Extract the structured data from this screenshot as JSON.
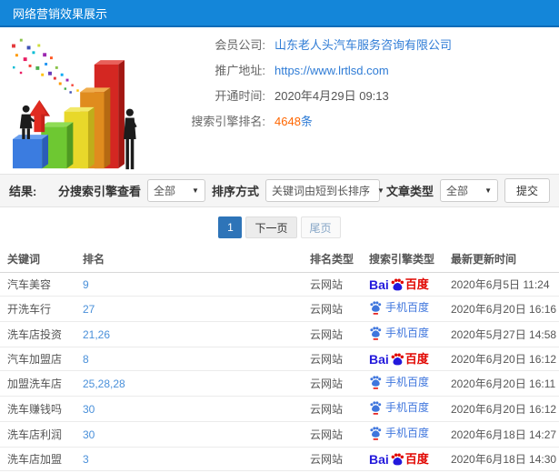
{
  "header": {
    "title": "网络营销效果展示"
  },
  "info": {
    "company_label": "会员公司:",
    "company_value": "山东老人头汽车服务咨询有限公司",
    "url_label": "推广地址:",
    "url_value": "https://www.lrtlsd.com",
    "opened_label": "开通时间:",
    "opened_value": "2020年4月29日 09:13",
    "rank_label": "搜索引擎排名:",
    "rank_count": "4648",
    "rank_unit": "条"
  },
  "filters": {
    "result_label": "结果:",
    "engine_label": "分搜索引擎查看",
    "engine_value": "全部",
    "sort_label": "排序方式",
    "sort_value": "关键词由短到长排序",
    "type_label": "文章类型",
    "type_value": "全部",
    "submit_label": "提交"
  },
  "pagination": {
    "current": "1",
    "next": "下一页",
    "last": "尾页"
  },
  "table": {
    "headers": [
      "关键词",
      "排名",
      "排名类型",
      "搜索引擎类型",
      "最新更新时间"
    ],
    "engine_labels": {
      "baidu": {
        "bai": "Bai",
        "du": "百度"
      },
      "shouji_baidu": {
        "text": "手机百度"
      }
    },
    "rows": [
      {
        "keyword": "汽车美容",
        "rank": "9",
        "rank_type": "云网站",
        "engine": "baidu",
        "time": "2020年6月5日 11:24"
      },
      {
        "keyword": "开洗车行",
        "rank": "27",
        "rank_type": "云网站",
        "engine": "shouji_baidu",
        "time": "2020年6月20日 16:16"
      },
      {
        "keyword": "洗车店投资",
        "rank": "21,26",
        "rank_type": "云网站",
        "engine": "shouji_baidu",
        "time": "2020年5月27日 14:58"
      },
      {
        "keyword": "汽车加盟店",
        "rank": "8",
        "rank_type": "云网站",
        "engine": "baidu",
        "time": "2020年6月20日 16:12"
      },
      {
        "keyword": "加盟洗车店",
        "rank": "25,28,28",
        "rank_type": "云网站",
        "engine": "shouji_baidu",
        "time": "2020年6月20日 16:11"
      },
      {
        "keyword": "洗车赚钱吗",
        "rank": "30",
        "rank_type": "云网站",
        "engine": "shouji_baidu",
        "time": "2020年6月20日 16:12"
      },
      {
        "keyword": "洗车店利润",
        "rank": "30",
        "rank_type": "云网站",
        "engine": "shouji_baidu",
        "time": "2020年6月18日 14:27"
      },
      {
        "keyword": "洗车店加盟",
        "rank": "3",
        "rank_type": "云网站",
        "engine": "baidu",
        "time": "2020年6月18日 14:30"
      }
    ]
  },
  "colors": {
    "header_blue": "#1486d9",
    "link_blue": "#2f7cd6",
    "count_orange": "#ff6600",
    "baidu_blue": "#2319dc",
    "baidu_red": "#e10601",
    "mobile_blue": "#3f76dd"
  }
}
